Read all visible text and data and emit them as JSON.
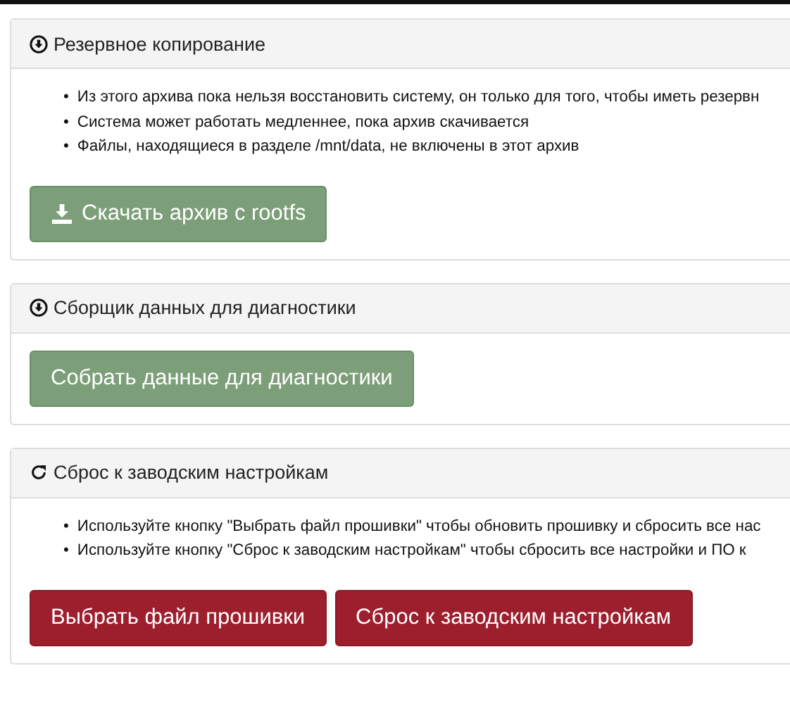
{
  "panels": [
    {
      "title": "Резервное копирование",
      "notes": [
        {
          "bullet": "•",
          "text": "Из этого архива пока нельзя восстановить систему, он только для того, чтобы иметь резервн"
        },
        {
          "bullet": "•",
          "text": "Система может работать медленнее, пока архив скачивается"
        },
        {
          "bullet": "•",
          "text": "Файлы, находящиеся в разделе /mnt/data, не включены в этот архив"
        }
      ],
      "buttons": [
        {
          "label": "Скачать архив с rootfs",
          "kind": "success"
        }
      ]
    },
    {
      "title": "Сборщик данных для диагностики",
      "buttons": [
        {
          "label": "Собрать данные для диагностики",
          "kind": "success"
        }
      ]
    },
    {
      "title": "Сброс к заводским настройкам",
      "notes": [
        {
          "bullet": "•",
          "text": "Используйте кнопку \"Выбрать файл прошивки\" чтобы обновить прошивку и сбросить все нас"
        },
        {
          "bullet": "•",
          "text": "Используйте кнопку \"Сброс к заводским настройкам\" чтобы сбросить все настройки и ПО к"
        }
      ],
      "buttons": [
        {
          "label": "Выбрать файл прошивки",
          "kind": "danger"
        },
        {
          "label": "Сброс к заводским настройкам",
          "kind": "danger"
        }
      ]
    }
  ]
}
